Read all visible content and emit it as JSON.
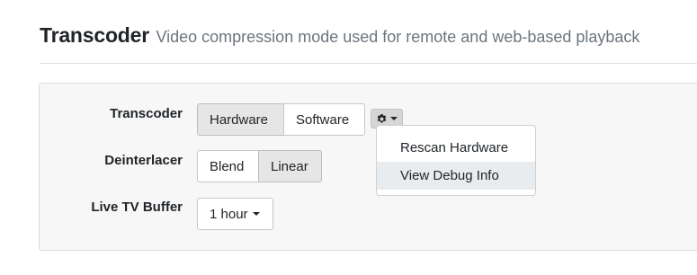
{
  "header": {
    "title": "Transcoder",
    "subtitle": "Video compression mode used for remote and web-based playback"
  },
  "form": {
    "transcoder": {
      "label": "Transcoder",
      "options": [
        "Hardware",
        "Software"
      ],
      "selected": "Hardware"
    },
    "settings_menu": {
      "icon": "gear-icon",
      "items": [
        "Rescan Hardware",
        "View Debug Info"
      ],
      "highlighted": "View Debug Info"
    },
    "deinterlacer": {
      "label": "Deinterlacer",
      "options": [
        "Blend",
        "Linear"
      ],
      "selected": "Linear"
    },
    "live_tv_buffer": {
      "label": "Live TV Buffer",
      "value": "1 hour"
    }
  }
}
